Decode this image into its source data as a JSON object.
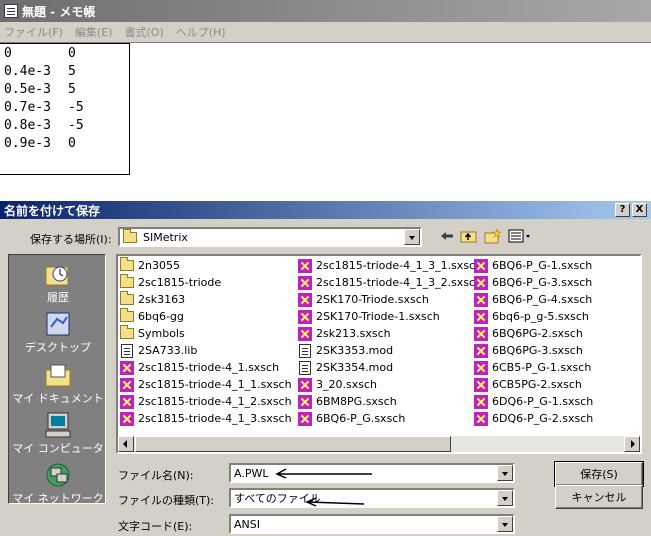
{
  "notepad": {
    "title": "無題 - メモ帳",
    "menu": [
      "ファイル(F)",
      "編集(E)",
      "書式(O)",
      "ヘルプ(H)"
    ],
    "lines": [
      {
        "a": "0",
        "b": "0"
      },
      {
        "a": "0.4e-3",
        "b": "5"
      },
      {
        "a": "0.5e-3",
        "b": "5"
      },
      {
        "a": "0.7e-3",
        "b": "-5"
      },
      {
        "a": "0.8e-3",
        "b": "-5"
      },
      {
        "a": "0.9e-3",
        "b": "0"
      }
    ]
  },
  "dialog": {
    "title": "名前を付けて保存",
    "help_label": "?",
    "close_label": "X",
    "save_in_label": "保存する場所(I):",
    "save_in_value": "SIMetrix",
    "places": [
      "履歴",
      "デスクトップ",
      "マイ ドキュメント",
      "マイ コンピュータ",
      "マイ ネットワーク"
    ],
    "files": [
      [
        {
          "name": "2n3055",
          "type": "folder"
        },
        {
          "name": "2sc1815-triode",
          "type": "folder"
        },
        {
          "name": "2sk3163",
          "type": "folder"
        },
        {
          "name": "6bq6-gg",
          "type": "folder"
        },
        {
          "name": "Symbols",
          "type": "folder"
        },
        {
          "name": "2SA733.lib",
          "type": "doc"
        },
        {
          "name": "2sc1815-triode-4_1.sxsch",
          "type": "sxsch"
        },
        {
          "name": "2sc1815-triode-4_1_1.sxsch",
          "type": "sxsch"
        },
        {
          "name": "2sc1815-triode-4_1_2.sxsch",
          "type": "sxsch"
        },
        {
          "name": "2sc1815-triode-4_1_3.sxsch",
          "type": "sxsch"
        }
      ],
      [
        {
          "name": "2sc1815-triode-4_1_3_1.sxsch",
          "type": "sxsch"
        },
        {
          "name": "2sc1815-triode-4_1_3_2.sxsch",
          "type": "sxsch"
        },
        {
          "name": "2SK170-Triode.sxsch",
          "type": "sxsch"
        },
        {
          "name": "2SK170-Triode-1.sxsch",
          "type": "sxsch"
        },
        {
          "name": "2sk213.sxsch",
          "type": "sxsch"
        },
        {
          "name": "2SK3353.mod",
          "type": "doc"
        },
        {
          "name": "2SK3354.mod",
          "type": "doc"
        },
        {
          "name": "3_20.sxsch",
          "type": "sxsch"
        },
        {
          "name": "6BM8PG.sxsch",
          "type": "sxsch"
        },
        {
          "name": "6BQ6-P_G.sxsch",
          "type": "sxsch"
        }
      ],
      [
        {
          "name": "6BQ6-P_G-1.sxsch",
          "type": "sxsch"
        },
        {
          "name": "6BQ6-P_G-3.sxsch",
          "type": "sxsch"
        },
        {
          "name": "6BQ6-P_G-4.sxsch",
          "type": "sxsch"
        },
        {
          "name": "6bq6-p_g-5.sxsch",
          "type": "sxsch"
        },
        {
          "name": "6BQ6PG-2.sxsch",
          "type": "sxsch"
        },
        {
          "name": "6BQ6PG-3.sxsch",
          "type": "sxsch"
        },
        {
          "name": "6CB5-P_G-1.sxsch",
          "type": "sxsch"
        },
        {
          "name": "6CB5PG-2.sxsch",
          "type": "sxsch"
        },
        {
          "name": "6DQ6-P_G-1.sxsch",
          "type": "sxsch"
        },
        {
          "name": "6DQ6-P_G-2.sxsch",
          "type": "sxsch"
        }
      ]
    ],
    "filename_label": "ファイル名(N):",
    "filename_value": "A.PWL",
    "filetype_label": "ファイルの種類(T):",
    "filetype_value": "すべてのファイル",
    "encoding_label": "文字コード(E):",
    "encoding_value": "ANSI",
    "save_button": "保存(S)",
    "cancel_button": "キャンセル"
  }
}
